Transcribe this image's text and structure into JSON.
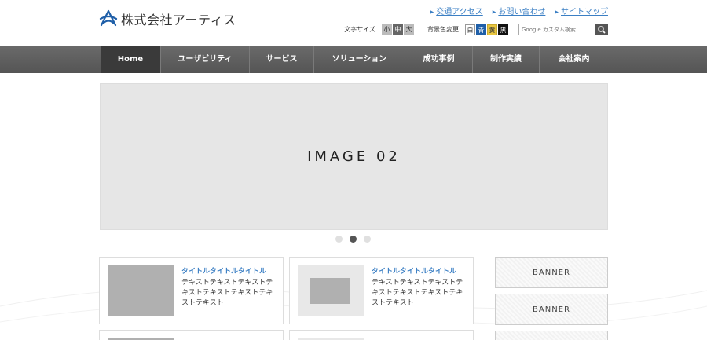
{
  "logo": {
    "text": "株式会社アーティス"
  },
  "top_links": [
    "交通アクセス",
    "お問い合わせ",
    "サイトマップ"
  ],
  "tools": {
    "font_size_label": "文字サイズ",
    "font_sizes": [
      "小",
      "中",
      "大"
    ],
    "bg_color_label": "背景色変更",
    "bg_colors": [
      "白",
      "青",
      "黄",
      "黒"
    ],
    "search_placeholder": "Google カスタム検索"
  },
  "nav": {
    "items": [
      "Home",
      "ユーザビリティ",
      "サービス",
      "ソリューション",
      "成功事例",
      "制作実績",
      "会社案内"
    ]
  },
  "slider": {
    "label": "IMAGE 02",
    "current": 2,
    "total": 3
  },
  "articles": [
    {
      "title": "タイトルタイトルタイトル",
      "body": "テキストテキストテキストテキストテキストテキストテキストテキスト"
    },
    {
      "title": "タイトルタイトルタイトル",
      "body": "テキストテキストテキストテキストテキストテキストテキストテキスト"
    }
  ],
  "banners": [
    "BANNER",
    "BANNER"
  ],
  "colors": {
    "accent": "#3b7fc4",
    "nav_bg": "#555555",
    "nav_active": "#3a3a3a"
  }
}
